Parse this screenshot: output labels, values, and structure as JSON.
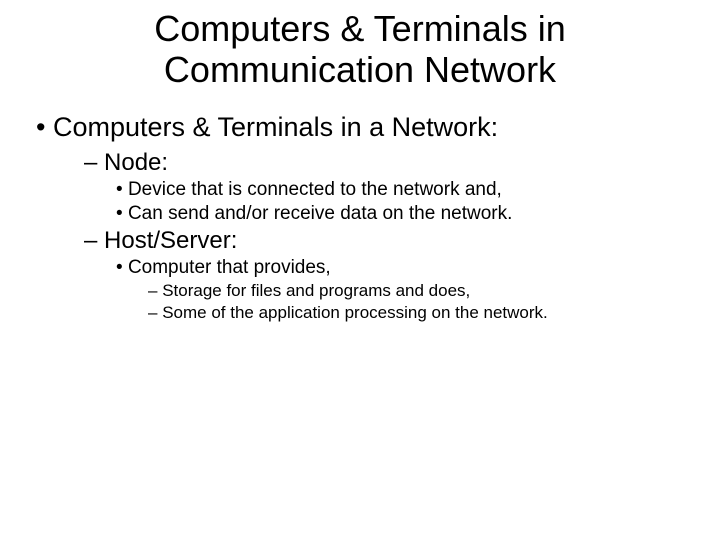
{
  "title_line1": "Computers & Terminals in",
  "title_line2": "Communication Network",
  "b1": "Computers & Terminals in a Network:",
  "b1_1": "Node:",
  "b1_1_1": "Device that is connected to the network and,",
  "b1_1_2": "Can send and/or receive data on the network.",
  "b1_2": "Host/Server:",
  "b1_2_1": "Computer that provides,",
  "b1_2_1_1": "Storage for files and programs and does,",
  "b1_2_1_2": "Some of the application processing on the network."
}
